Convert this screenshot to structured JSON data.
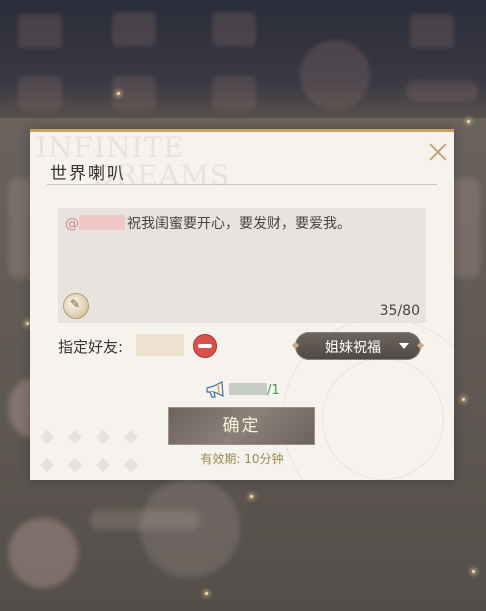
{
  "dialog": {
    "title": "世界喇叭",
    "watermark_line1": "INFINITE",
    "watermark_line2": "DREAMS",
    "message": {
      "at_symbol": "@",
      "text": "祝我闺蜜要开心，要发财，要爱我。",
      "char_count": "35/80"
    },
    "friend_label": "指定好友:",
    "dropdown_selected": "姐妹祝福",
    "horn_count_suffix": "/1",
    "confirm_label": "确定",
    "validity_text": "有效期: 10分钟"
  },
  "colors": {
    "accent_gold": "#c9a064",
    "remove_red": "#d6524b",
    "count_green": "#4a9b4c"
  },
  "icons": [
    "close-icon",
    "emoji-icon",
    "remove-icon",
    "dropdown-arrow-icon",
    "horn-icon"
  ]
}
